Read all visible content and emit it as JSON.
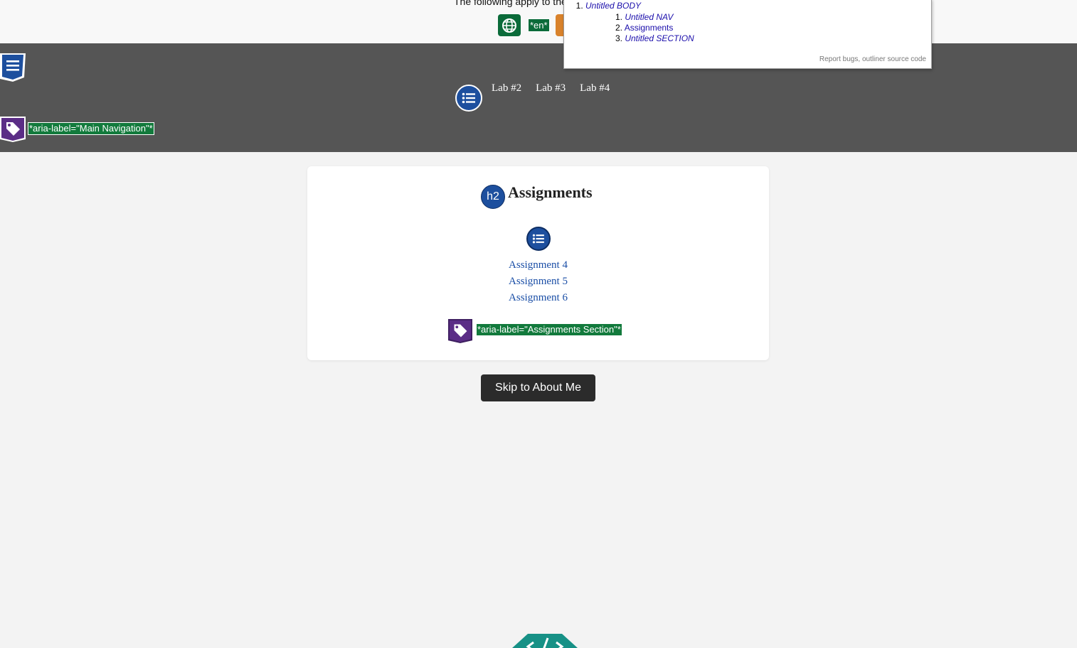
{
  "top": {
    "text": "The following apply to the",
    "lang_tag": "*en*"
  },
  "outliner": {
    "root": "Untitled BODY",
    "items": [
      "Untitled NAV",
      "Assignments",
      "Untitled SECTION"
    ],
    "footer_bugs": "Report bugs",
    "footer_sep": ", ",
    "footer_source": "outliner source code"
  },
  "nav": {
    "links": [
      "Lab #2",
      "Lab #3",
      "Lab #4"
    ],
    "aria_label": "*aria-label=\"Main Navigation\"*"
  },
  "section": {
    "heading_badge": "h2",
    "title": "Assignments",
    "assignments": [
      "Assignment 4",
      "Assignment 5",
      "Assignment 6"
    ],
    "aria_label": "*aria-label=\"Assignments Section\"*"
  },
  "skip_button": "Skip to About Me",
  "colors": {
    "nav_bg": "#555555",
    "page_bg": "#f3f3f3",
    "badge_blue": "#1d4f9e",
    "badge_green": "#127a3c",
    "badge_purple": "#5b2d86",
    "badge_teal": "#179186"
  }
}
